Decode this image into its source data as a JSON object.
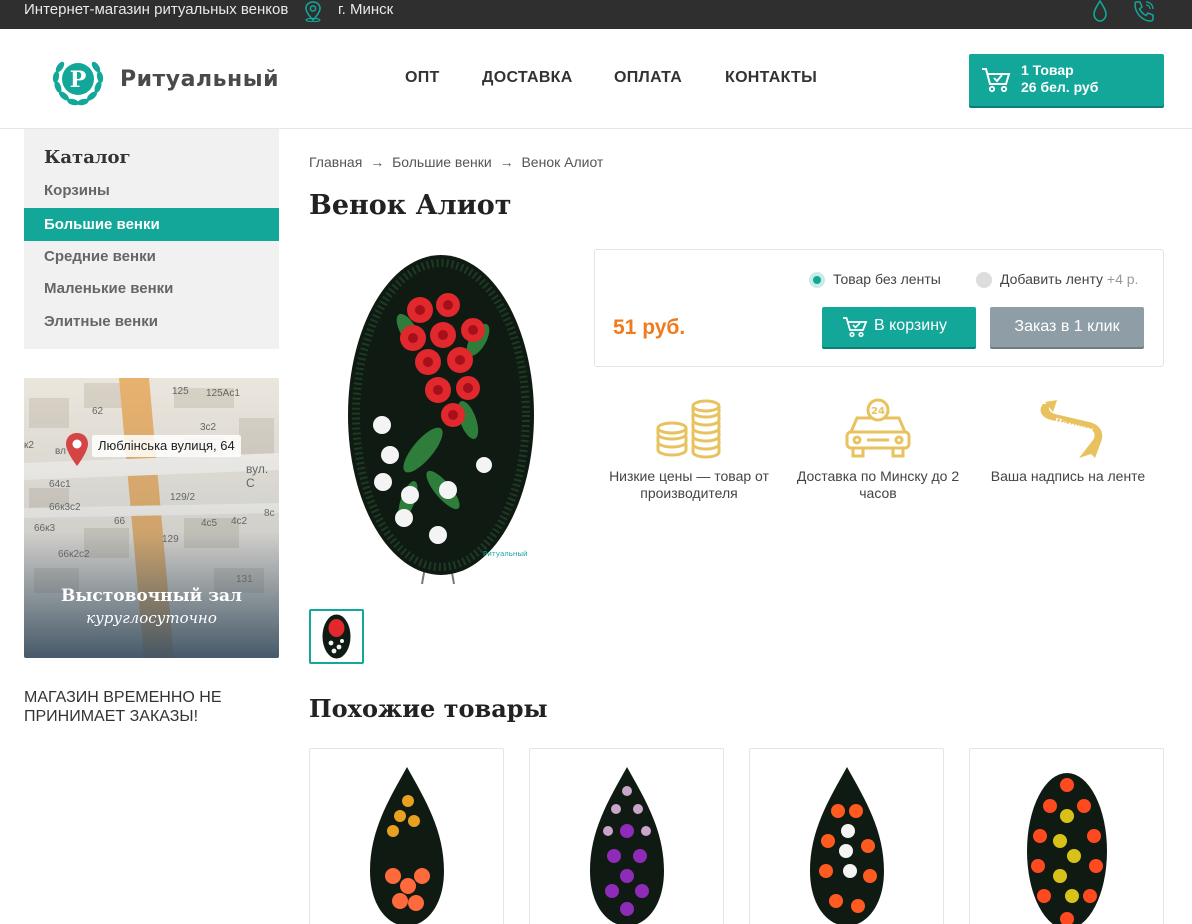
{
  "topbar": {
    "tagline": "Интернет-магазин ритуальных венков",
    "city": "г. Минск"
  },
  "header": {
    "logo_text": "Ритуальный",
    "nav": [
      "ОПТ",
      "ДОСТАВКА",
      "ОПЛАТА",
      "КОНТАКТЫ"
    ],
    "cart_line1": "1 Товар",
    "cart_line2": "26 бел. руб"
  },
  "sidebar": {
    "catalog_title": "Каталог",
    "items": [
      {
        "label": "Корзины",
        "active": false
      },
      {
        "label": "Большие венки",
        "active": true
      },
      {
        "label": "Средние венки",
        "active": false
      },
      {
        "label": "Маленькие венки",
        "active": false
      },
      {
        "label": "Элитные венки",
        "active": false
      }
    ],
    "map": {
      "address": "Люблінська вулиця, 64",
      "title": "Выстовочный зал",
      "subtitle": "куруглосуточно",
      "labels": [
        "125",
        "125Ас1",
        "62",
        "3с2",
        "к2",
        "вл",
        "вул. С",
        "64с1",
        "129/2",
        "66к3с2",
        "66",
        "4с5",
        "4с2",
        "8с",
        "66к3",
        "129",
        "66к2с2",
        "131"
      ]
    },
    "notice": "МАГАЗИН ВРЕМЕННО НЕ ПРИНИМАЕТ ЗАКАЗЫ!"
  },
  "breadcrumb": [
    "Главная",
    "→",
    "Большие венки",
    "→",
    "Венок Алиот"
  ],
  "product": {
    "title": "Венок Алиот",
    "option_no_ribbon": "Товар без ленты",
    "option_add_ribbon": "Добавить ленту",
    "option_add_ribbon_extra": "+4 р.",
    "price": "51 руб.",
    "add_to_cart": "В корзину",
    "one_click": "Заказ в 1 клик",
    "image_watermark": "Ритуальный"
  },
  "features": [
    {
      "icon": "coins-icon",
      "text": "Низкие цены — товар от производителя"
    },
    {
      "icon": "delivery-car-icon",
      "text": "Доставка по Минску до 2 часов"
    },
    {
      "icon": "ribbon-icon",
      "text": "Ваша надпись на ленте",
      "ribbon_word": "Помним"
    }
  ],
  "similar": {
    "title": "Похожие товары"
  },
  "colors": {
    "accent": "#13a79a",
    "price": "#f07a1e",
    "gold": "#e8c25e",
    "topbar": "#2f2f2f"
  }
}
